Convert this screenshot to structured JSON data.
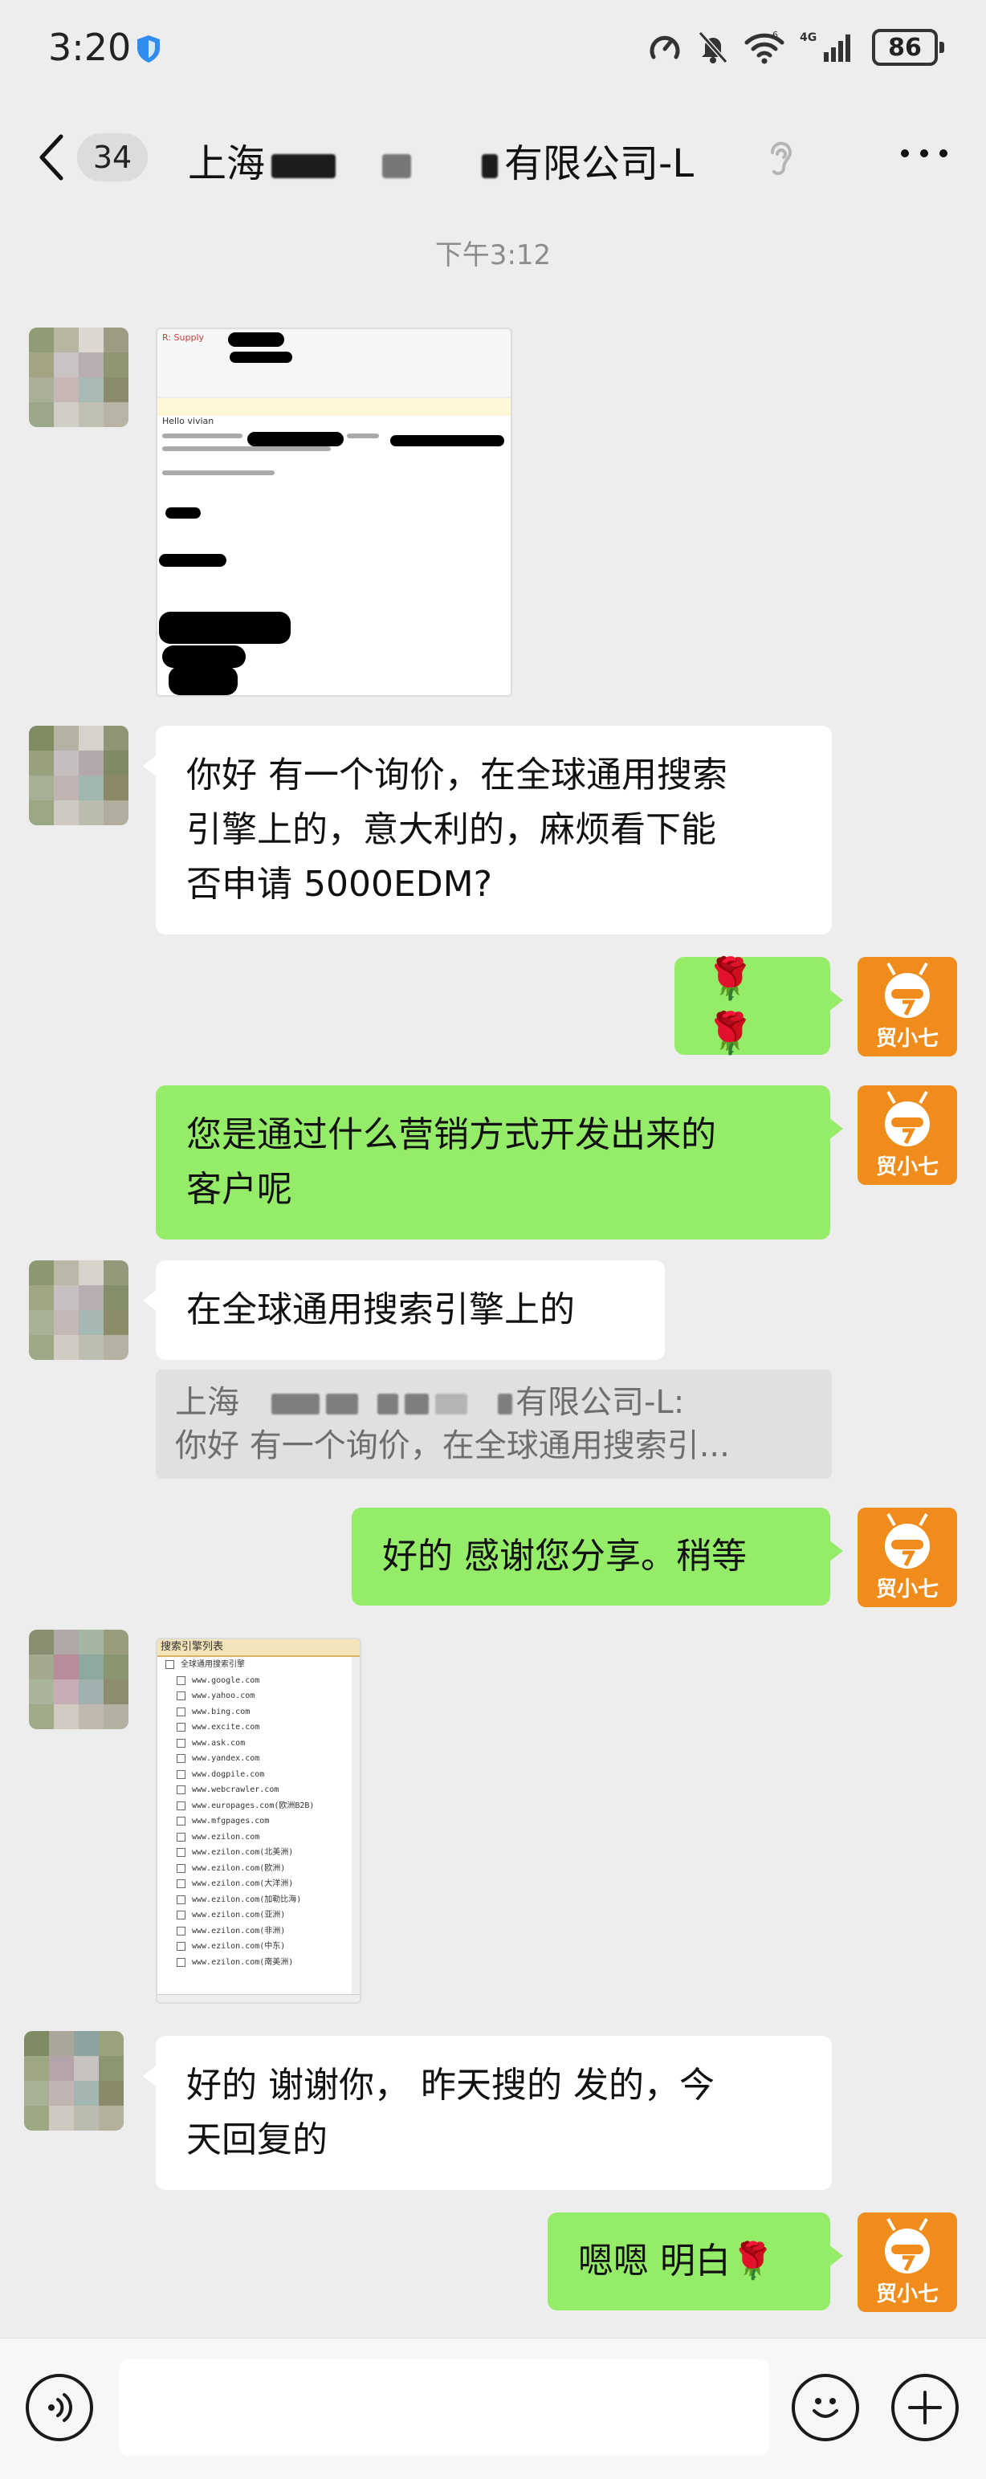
{
  "status_bar": {
    "time": "3:20",
    "network": "4G",
    "battery": "86"
  },
  "nav": {
    "unread_count": "34",
    "title_start": "上海",
    "title_end": "有限公司-L"
  },
  "timestamp": "下午3:12",
  "me": {
    "avatar_label": "贸小七"
  },
  "messages": [
    {
      "side": "in",
      "type": "image",
      "kind": "email-screenshot",
      "subject": "R: Supply",
      "greeting": "Hello vivian"
    },
    {
      "side": "in",
      "type": "text",
      "lines": [
        "你好 有一个询价，在全球通用搜索",
        "引擎上的，意大利的，麻烦看下能",
        "否申请 5000EDM?"
      ]
    },
    {
      "side": "out",
      "type": "text",
      "text": "🌹🌹"
    },
    {
      "side": "out",
      "type": "text",
      "lines": [
        "您是通过什么营销方式开发出来的",
        "客户呢"
      ]
    },
    {
      "side": "in",
      "type": "text",
      "text": "在全球通用搜索引擎上的"
    },
    {
      "side": "quote",
      "quote_line1_start": "上海",
      "quote_line1_end": "有限公司-L:",
      "quote_line2": "你好 有一个询价，在全球通用搜索引..."
    },
    {
      "side": "out",
      "type": "text",
      "text": "好的 感谢您分享。稍等"
    },
    {
      "side": "in",
      "type": "image",
      "kind": "search-engine-list"
    },
    {
      "side": "in",
      "type": "text",
      "lines": [
        "好的 谢谢你， 昨天搜的 发的，今",
        "天回复的"
      ]
    },
    {
      "side": "out",
      "type": "text",
      "text": "嗯嗯 明白🌹"
    }
  ],
  "search_list": {
    "title": "搜索引擎列表",
    "root": "全球通用搜索引擎",
    "items": [
      "www.google.com",
      "www.yahoo.com",
      "www.bing.com",
      "www.excite.com",
      "www.ask.com",
      "www.yandex.com",
      "www.dogpile.com",
      "www.webcrawler.com",
      "www.europages.com(欧洲B2B)",
      "www.mfgpages.com",
      "www.ezilon.com",
      "www.ezilon.com(北美洲)",
      "www.ezilon.com(欧洲)",
      "www.ezilon.com(大洋洲)",
      "www.ezilon.com(加勒比海)",
      "www.ezilon.com(亚洲)",
      "www.ezilon.com(非洲)",
      "www.ezilon.com(中东)",
      "www.ezilon.com(南美洲)"
    ]
  },
  "colors": {
    "background": "#ededed",
    "bubble_out": "#95ec69",
    "bubble_in": "#ffffff",
    "me_avatar": "#f08c1c"
  }
}
